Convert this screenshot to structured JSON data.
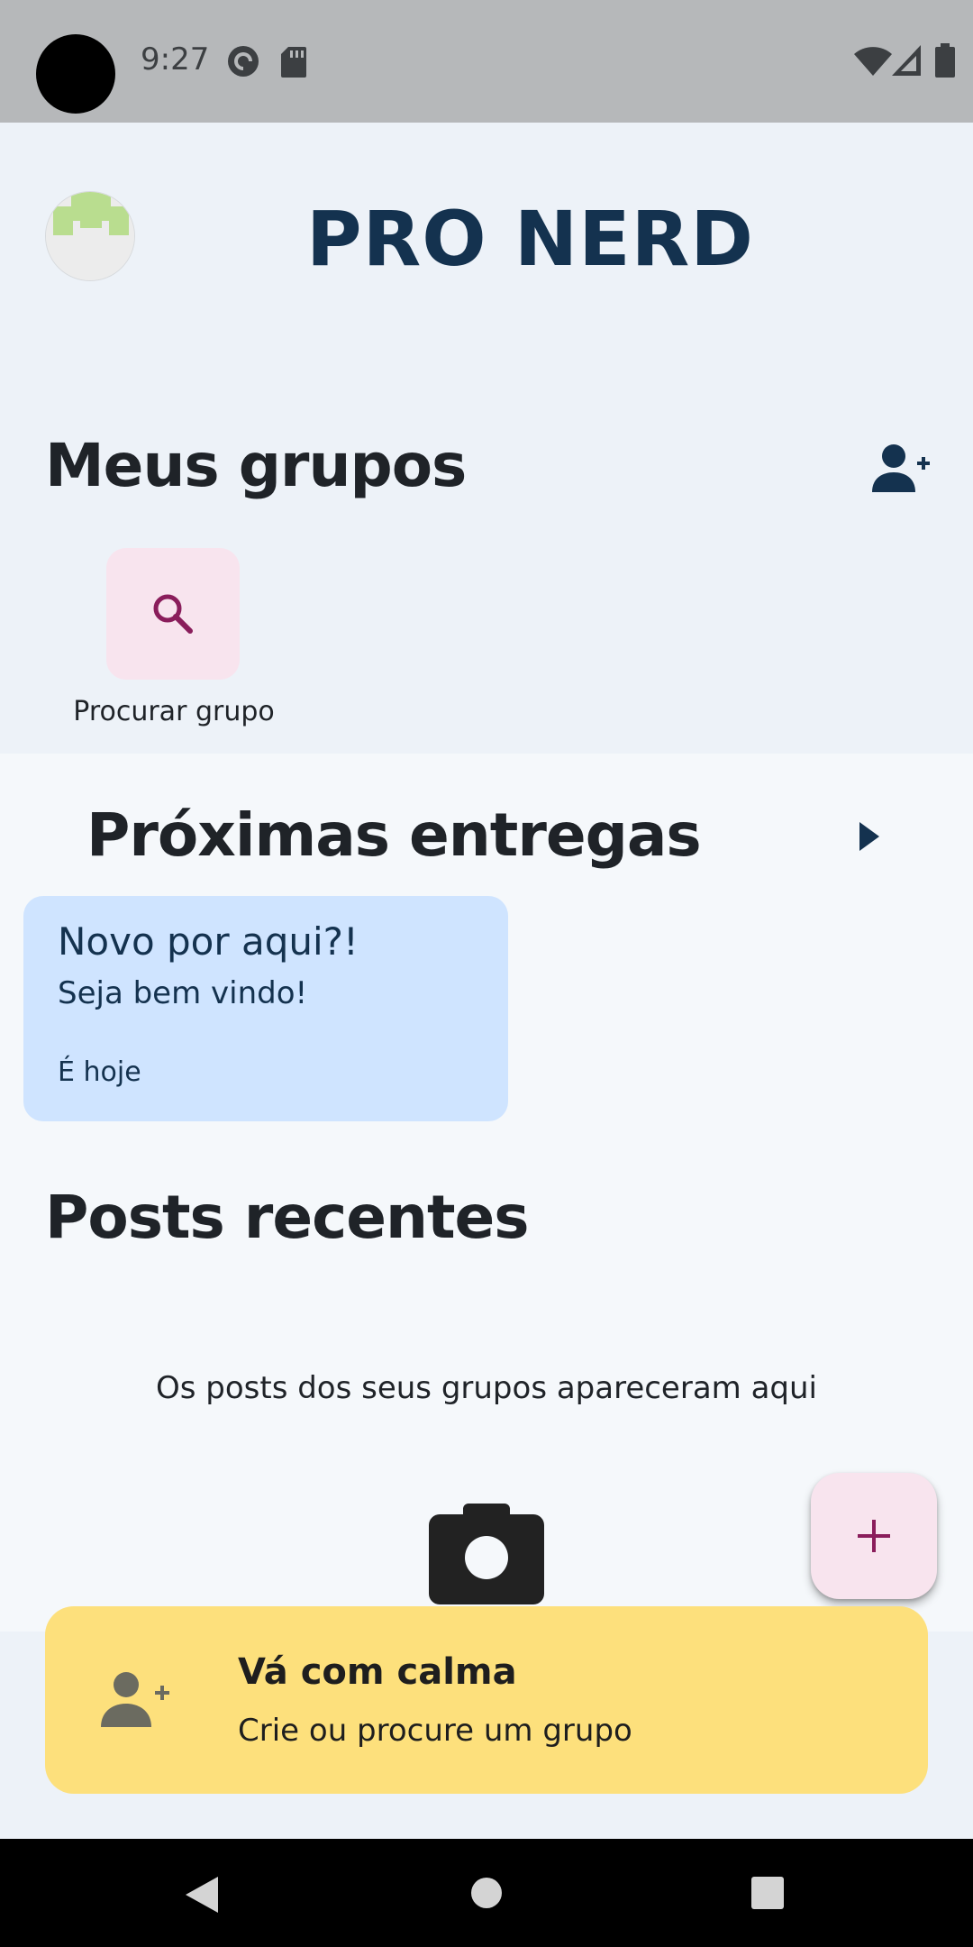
{
  "status_bar": {
    "time": "9:27",
    "left_icons": [
      "pocket-casts-icon",
      "sd-card-icon"
    ],
    "right_icons": [
      "wifi-icon",
      "cellular-signal-icon",
      "battery-icon"
    ]
  },
  "header": {
    "avatar_icon": "pixel-avatar-icon",
    "title": "PRO NERD"
  },
  "groups": {
    "title": "Meus grupos",
    "add_icon": "add-person-icon",
    "search_tile": {
      "icon": "search-icon",
      "label": "Procurar grupo"
    }
  },
  "deliveries": {
    "title": "Próximas entregas",
    "arrow_icon": "play-arrow-icon",
    "cards": [
      {
        "title": "Novo por aqui?!",
        "subtitle": "Seja bem vindo!",
        "date": "É hoje"
      }
    ]
  },
  "posts": {
    "title": "Posts recentes",
    "empty_message": "Os posts dos seus grupos apareceram aqui",
    "empty_icon": "camera-icon"
  },
  "fab": {
    "icon": "plus-icon"
  },
  "banner": {
    "icon": "add-person-icon",
    "title": "Vá com calma",
    "subtitle": "Crie ou procure um grupo"
  },
  "nav_bar": {
    "buttons": [
      "back",
      "home",
      "recents"
    ]
  },
  "colors": {
    "status_bar": "#b6b8ba",
    "header_bg": "#edf2f8",
    "content_bg": "#f5f8fb",
    "title_navy": "#14324f",
    "card_blue": "#cfe4ff",
    "tile_pink": "#f8e4ee",
    "accent_magenta": "#8a1d5b",
    "banner_yellow": "#fde07c"
  }
}
